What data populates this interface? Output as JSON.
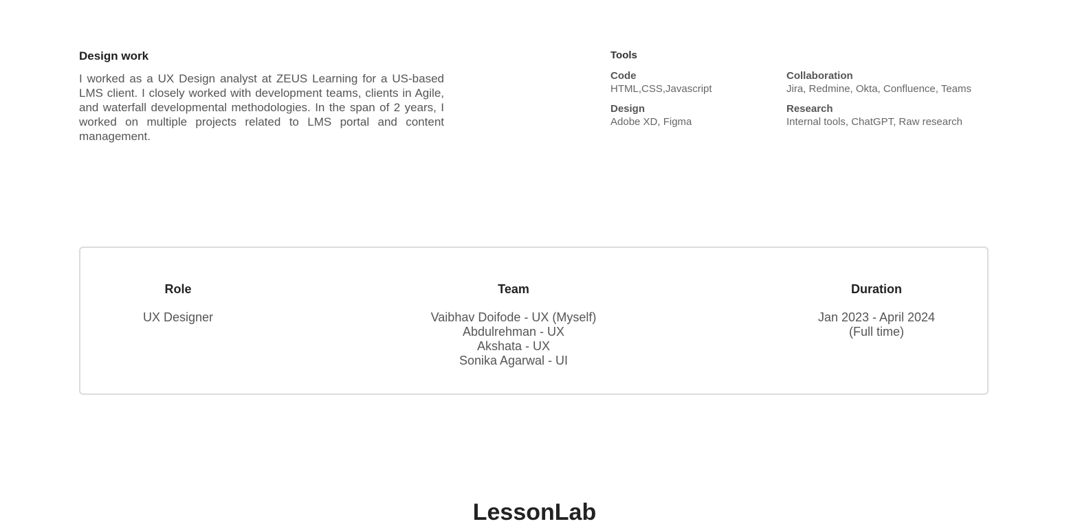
{
  "design_work": {
    "title": "Design work",
    "body": "I worked as a UX Design analyst at ZEUS Learning for a US-based LMS client. I closely worked with development teams, clients in Agile, and waterfall developmental methodologies. In the span of 2 years, I worked on multiple projects related to LMS portal and content management."
  },
  "tools": {
    "title": "Tools",
    "items": [
      {
        "label": "Code",
        "value": "HTML,CSS,Javascript"
      },
      {
        "label": "Collaboration",
        "value": "Jira, Redmine, Okta, Confluence, Teams"
      },
      {
        "label": "Design",
        "value": "Adobe XD, Figma"
      },
      {
        "label": "Research",
        "value": "Internal tools, ChatGPT, Raw research"
      }
    ]
  },
  "project_info": {
    "role": {
      "title": "Role",
      "lines": [
        "UX Designer"
      ]
    },
    "team": {
      "title": "Team",
      "lines": [
        "Vaibhav Doifode - UX (Myself)",
        "Abdulrehman - UX",
        "Akshata - UX",
        "Sonika Agarwal - UI"
      ]
    },
    "duration": {
      "title": "Duration",
      "lines": [
        "Jan 2023 - April 2024",
        "(Full time)"
      ]
    }
  },
  "next_section": {
    "title": "LessonLab"
  }
}
